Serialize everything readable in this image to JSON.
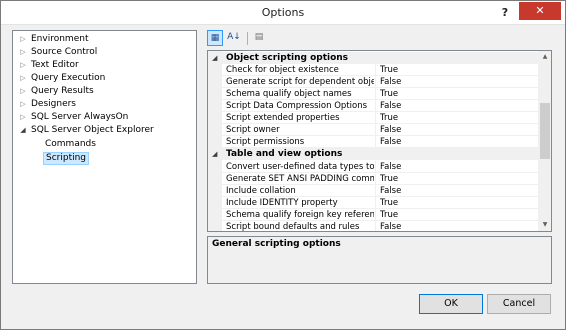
{
  "window": {
    "title": "Options",
    "help_label": "?",
    "close_label": "✕"
  },
  "tree": {
    "items": [
      {
        "label": "Environment",
        "arrow": "▷"
      },
      {
        "label": "Source Control",
        "arrow": "▷"
      },
      {
        "label": "Text Editor",
        "arrow": "▷"
      },
      {
        "label": "Query Execution",
        "arrow": "▷"
      },
      {
        "label": "Query Results",
        "arrow": "▷"
      },
      {
        "label": "Designers",
        "arrow": "▷"
      },
      {
        "label": "SQL Server AlwaysOn",
        "arrow": "▷"
      },
      {
        "label": "SQL Server Object Explorer",
        "arrow": "◢"
      },
      {
        "label": "Commands",
        "arrow": ""
      },
      {
        "label": "Scripting",
        "arrow": ""
      }
    ]
  },
  "toolbar": {
    "categorized_icon": "▦",
    "alphabetical_icon": "A↓",
    "property_pages_icon": "▤"
  },
  "grid": {
    "categories": [
      {
        "label": "Object scripting options",
        "toggle": "◢",
        "rows": [
          {
            "name": "Check for object existence",
            "value": "True"
          },
          {
            "name": "Generate script for dependent objects",
            "value": "False"
          },
          {
            "name": "Schema qualify object names",
            "value": "True"
          },
          {
            "name": "Script Data Compression Options",
            "value": "False"
          },
          {
            "name": "Script extended properties",
            "value": "True"
          },
          {
            "name": "Script owner",
            "value": "False"
          },
          {
            "name": "Script permissions",
            "value": "False"
          }
        ]
      },
      {
        "label": "Table and view options",
        "toggle": "◢",
        "rows": [
          {
            "name": "Convert user-defined data types to base",
            "value": "False"
          },
          {
            "name": "Generate SET ANSI PADDING commands",
            "value": "True"
          },
          {
            "name": "Include collation",
            "value": "False"
          },
          {
            "name": "Include IDENTITY property",
            "value": "True"
          },
          {
            "name": "Schema qualify foreign key references",
            "value": "True"
          },
          {
            "name": "Script bound defaults and rules",
            "value": "False"
          }
        ]
      }
    ],
    "scroll_up": "▲",
    "scroll_down": "▼"
  },
  "description": {
    "title": "General scripting options"
  },
  "buttons": {
    "ok": "OK",
    "cancel": "Cancel"
  }
}
